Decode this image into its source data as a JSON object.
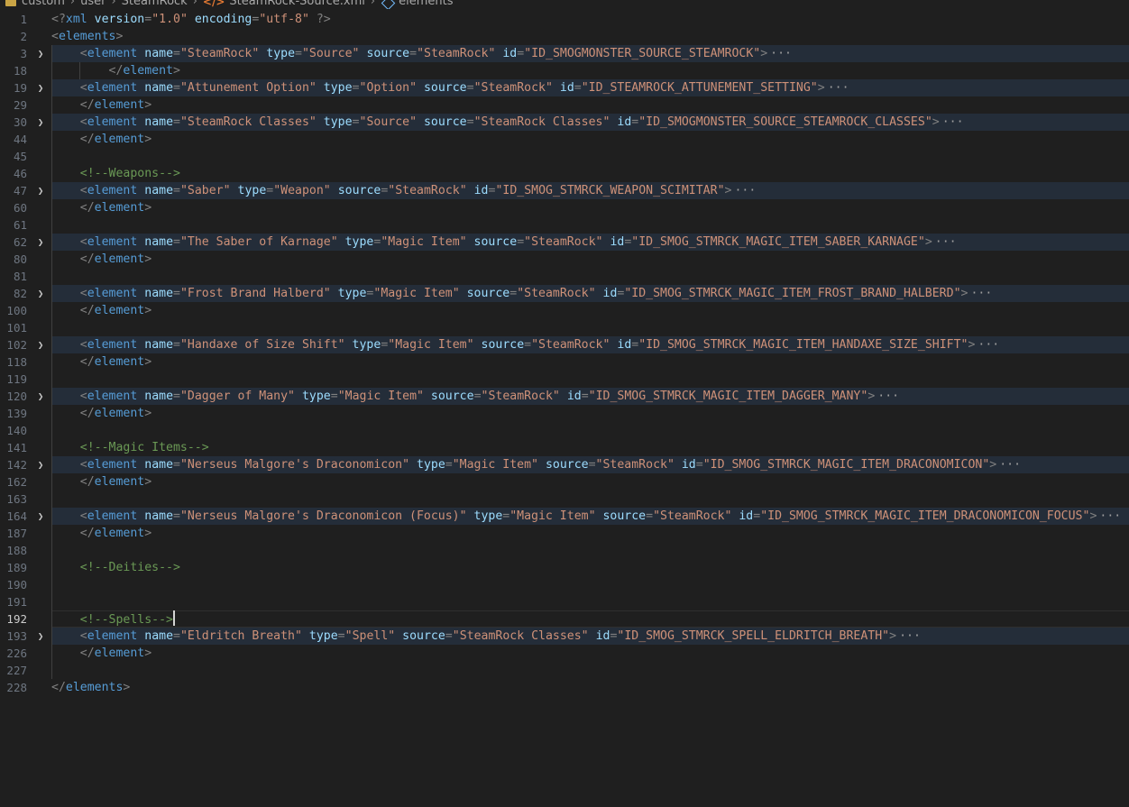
{
  "breadcrumb": [
    "custom",
    "user",
    "SteamRock",
    "SteamRock-Source.xml",
    "elements"
  ],
  "lines": [
    {
      "n": "1",
      "ind": 0,
      "kind": "decl",
      "text": "<?xml version=\"1.0\" encoding=\"utf-8\" ?>"
    },
    {
      "n": "2",
      "ind": 0,
      "kind": "open-root",
      "tag": "elements"
    },
    {
      "n": "3",
      "ind": 1,
      "kind": "element",
      "folded": true,
      "attrs": [
        [
          "name",
          "SteamRock"
        ],
        [
          "type",
          "Source"
        ],
        [
          "source",
          "SteamRock"
        ],
        [
          "id",
          "ID_SMOGMONSTER_SOURCE_STEAMROCK"
        ]
      ]
    },
    {
      "n": "18",
      "ind": 2,
      "kind": "close",
      "tag": "element"
    },
    {
      "n": "19",
      "ind": 1,
      "kind": "element",
      "folded": true,
      "attrs": [
        [
          "name",
          "Attunement Option"
        ],
        [
          "type",
          "Option"
        ],
        [
          "source",
          "SteamRock"
        ],
        [
          "id",
          "ID_STEAMROCK_ATTUNEMENT_SETTING"
        ]
      ]
    },
    {
      "n": "29",
      "ind": 1,
      "kind": "close",
      "tag": "element"
    },
    {
      "n": "30",
      "ind": 1,
      "kind": "element",
      "folded": true,
      "attrs": [
        [
          "name",
          "SteamRock Classes"
        ],
        [
          "type",
          "Source"
        ],
        [
          "source",
          "SteamRock Classes"
        ],
        [
          "id",
          "ID_SMOGMONSTER_SOURCE_STEAMROCK_CLASSES"
        ]
      ]
    },
    {
      "n": "44",
      "ind": 1,
      "kind": "close",
      "tag": "element"
    },
    {
      "n": "45",
      "ind": 0,
      "kind": "empty"
    },
    {
      "n": "46",
      "ind": 1,
      "kind": "comment",
      "text": "<!--Weapons-->"
    },
    {
      "n": "47",
      "ind": 1,
      "kind": "element",
      "folded": true,
      "attrs": [
        [
          "name",
          "Saber"
        ],
        [
          "type",
          "Weapon"
        ],
        [
          "source",
          "SteamRock"
        ],
        [
          "id",
          "ID_SMOG_STMRCK_WEAPON_SCIMITAR"
        ]
      ]
    },
    {
      "n": "60",
      "ind": 1,
      "kind": "close",
      "tag": "element"
    },
    {
      "n": "61",
      "ind": 0,
      "kind": "empty"
    },
    {
      "n": "62",
      "ind": 1,
      "kind": "element",
      "folded": true,
      "attrs": [
        [
          "name",
          "The Saber of Karnage"
        ],
        [
          "type",
          "Magic Item"
        ],
        [
          "source",
          "SteamRock"
        ],
        [
          "id",
          "ID_SMOG_STMRCK_MAGIC_ITEM_SABER_KARNAGE"
        ]
      ]
    },
    {
      "n": "80",
      "ind": 1,
      "kind": "close",
      "tag": "element"
    },
    {
      "n": "81",
      "ind": 0,
      "kind": "empty"
    },
    {
      "n": "82",
      "ind": 1,
      "kind": "element",
      "folded": true,
      "attrs": [
        [
          "name",
          "Frost Brand Halberd"
        ],
        [
          "type",
          "Magic Item"
        ],
        [
          "source",
          "SteamRock"
        ],
        [
          "id",
          "ID_SMOG_STMRCK_MAGIC_ITEM_FROST_BRAND_HALBERD"
        ]
      ]
    },
    {
      "n": "100",
      "ind": 1,
      "kind": "close",
      "tag": "element"
    },
    {
      "n": "101",
      "ind": 0,
      "kind": "empty"
    },
    {
      "n": "102",
      "ind": 1,
      "kind": "element",
      "folded": true,
      "attrs": [
        [
          "name",
          "Handaxe of Size Shift"
        ],
        [
          "type",
          "Magic Item"
        ],
        [
          "source",
          "SteamRock"
        ],
        [
          "id",
          "ID_SMOG_STMRCK_MAGIC_ITEM_HANDAXE_SIZE_SHIFT"
        ]
      ]
    },
    {
      "n": "118",
      "ind": 1,
      "kind": "close",
      "tag": "element"
    },
    {
      "n": "119",
      "ind": 0,
      "kind": "empty"
    },
    {
      "n": "120",
      "ind": 1,
      "kind": "element",
      "folded": true,
      "attrs": [
        [
          "name",
          "Dagger of Many"
        ],
        [
          "type",
          "Magic Item"
        ],
        [
          "source",
          "SteamRock"
        ],
        [
          "id",
          "ID_SMOG_STMRCK_MAGIC_ITEM_DAGGER_MANY"
        ]
      ]
    },
    {
      "n": "139",
      "ind": 1,
      "kind": "close",
      "tag": "element"
    },
    {
      "n": "140",
      "ind": 0,
      "kind": "empty"
    },
    {
      "n": "141",
      "ind": 1,
      "kind": "comment",
      "text": "<!--Magic Items-->"
    },
    {
      "n": "142",
      "ind": 1,
      "kind": "element",
      "folded": true,
      "attrs": [
        [
          "name",
          "Nerseus Malgore's Draconomicon"
        ],
        [
          "type",
          "Magic Item"
        ],
        [
          "source",
          "SteamRock"
        ],
        [
          "id",
          "ID_SMOG_STMRCK_MAGIC_ITEM_DRACONOMICON"
        ]
      ]
    },
    {
      "n": "162",
      "ind": 1,
      "kind": "close",
      "tag": "element"
    },
    {
      "n": "163",
      "ind": 0,
      "kind": "empty"
    },
    {
      "n": "164",
      "ind": 1,
      "kind": "element",
      "folded": true,
      "attrs": [
        [
          "name",
          "Nerseus Malgore's Draconomicon (Focus)"
        ],
        [
          "type",
          "Magic Item"
        ],
        [
          "source",
          "SteamRock"
        ],
        [
          "id",
          "ID_SMOG_STMRCK_MAGIC_ITEM_DRACONOMICON_FOCUS"
        ]
      ]
    },
    {
      "n": "187",
      "ind": 1,
      "kind": "close",
      "tag": "element"
    },
    {
      "n": "188",
      "ind": 0,
      "kind": "empty"
    },
    {
      "n": "189",
      "ind": 1,
      "kind": "comment",
      "text": "<!--Deities-->"
    },
    {
      "n": "190",
      "ind": 0,
      "kind": "empty"
    },
    {
      "n": "191",
      "ind": 0,
      "kind": "empty"
    },
    {
      "n": "192",
      "ind": 1,
      "kind": "comment",
      "text": "<!--Spells-->",
      "active": true
    },
    {
      "n": "193",
      "ind": 1,
      "kind": "element",
      "folded": true,
      "attrs": [
        [
          "name",
          "Eldritch Breath"
        ],
        [
          "type",
          "Spell"
        ],
        [
          "source",
          "SteamRock Classes"
        ],
        [
          "id",
          "ID_SMOG_STMRCK_SPELL_ELDRITCH_BREATH"
        ]
      ]
    },
    {
      "n": "226",
      "ind": 1,
      "kind": "close",
      "tag": "element"
    },
    {
      "n": "227",
      "ind": 0,
      "kind": "empty"
    },
    {
      "n": "228",
      "ind": 0,
      "kind": "close-root",
      "tag": "elements"
    }
  ],
  "colors": {
    "background": "#1f1f1f",
    "folded_line_highlight": "#242d39",
    "tag": "#569cd6",
    "attribute": "#9cdcfe",
    "string": "#ce9178",
    "comment": "#6a9955",
    "bracket": "#808080",
    "line_number": "#6e7681"
  },
  "icons": {
    "breadcrumb_folder": "folder-icon",
    "breadcrumb_file": "xml-file-icon",
    "breadcrumb_symbol": "symbol-element-icon",
    "fold": "chevron-right-icon"
  }
}
